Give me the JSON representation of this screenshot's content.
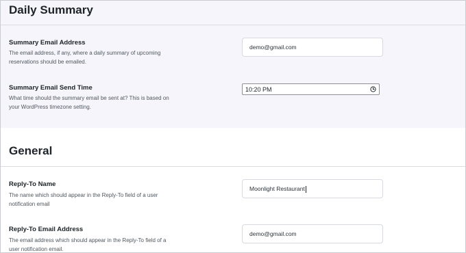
{
  "daily_summary": {
    "title": "Daily Summary",
    "summary_email": {
      "label": "Summary Email Address",
      "description": "The email address, if any, where a daily summary of upcoming reservations should be emailed.",
      "value": "demo@gmail.com"
    },
    "send_time": {
      "label": "Summary Email Send Time",
      "description": "What time should the summary email be sent at? This is based on your WordPress timezone setting.",
      "value": "10:20 PM",
      "icon": "clock-icon"
    }
  },
  "general": {
    "title": "General",
    "reply_to_name": {
      "label": "Reply-To Name",
      "description": "The name which should appear in the Reply-To field of a user notification email",
      "value": "Moonlight Restaurant"
    },
    "reply_to_email": {
      "label": "Reply-To Email Address",
      "description": "The email address which should appear in the Reply-To field of a user notification email.",
      "value": "demo@gmail.com"
    }
  }
}
